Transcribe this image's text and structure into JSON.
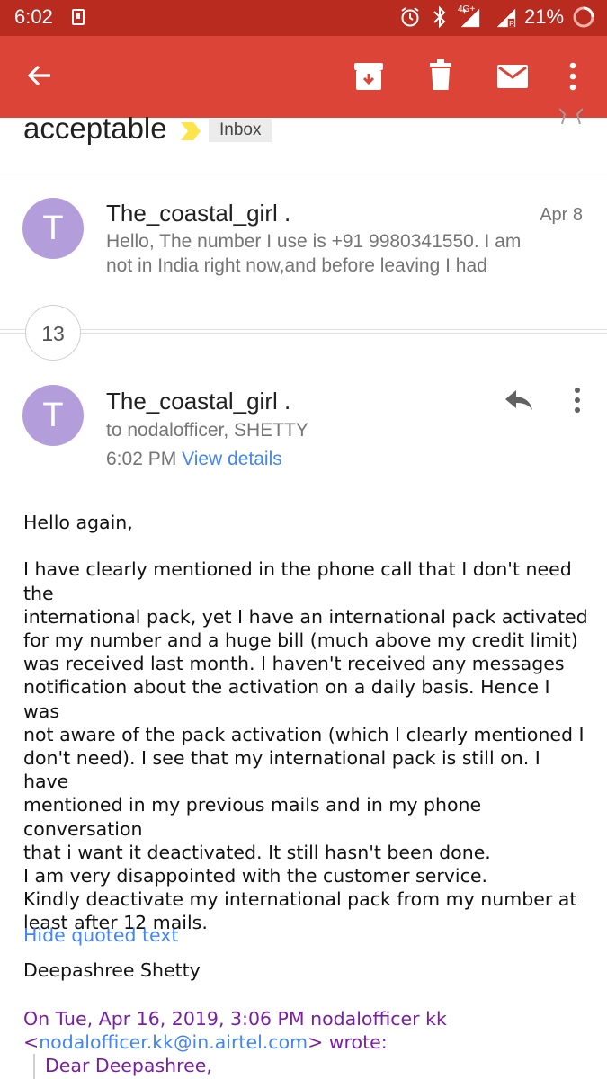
{
  "status_bar": {
    "time": "6:02",
    "battery": "21%",
    "network": "4G+"
  },
  "app_bar": {
    "icons": [
      "back-arrow-icon",
      "archive-icon",
      "delete-icon",
      "mail-icon",
      "more-vert-icon"
    ]
  },
  "thread": {
    "subject": "acceptable",
    "label": "Inbox",
    "collapsed_count": "13"
  },
  "messages": [
    {
      "avatar_letter": "T",
      "sender": "The_coastal_girl .",
      "date": "Apr 8",
      "snippet_line1": "Hello, The number I use is +91 9980341550. I am",
      "snippet_line2": "not in India right now,and before leaving I had"
    },
    {
      "avatar_letter": "T",
      "sender": "The_coastal_girl .",
      "recipients": "to nodalofficer, SHETTY",
      "time": "6:02 PM",
      "view_details": "View details",
      "body": {
        "greeting": "Hello again,",
        "paragraph": [
          "I have clearly mentioned in the phone call that I don't need the",
          "international pack, yet I have an international pack activated",
          "for my number and a huge bill (much above my credit limit)",
          "was received last month. I haven't received any messages",
          "notification about the activation on a daily basis. Hence I was",
          "not aware of the pack activation (which I clearly mentioned I",
          "don't need). I see that my international pack is still on. I have",
          "mentioned in my previous mails and in my phone conversation",
          "that i want it deactivated. It still hasn't been done.",
          "I am very disappointed with the customer service.",
          "Kindly deactivate my international pack from my number at",
          "least after 12 mails."
        ],
        "signature": "Deepashree Shetty",
        "hide_quoted": "Hide quoted text",
        "quote_header_line1": "On Tue, Apr 16, 2019, 3:06 PM nodalofficer kk",
        "quote_email": "nodalofficer.kk@in.airtel.com",
        "quote_open": "<",
        "quote_close": "> wrote:",
        "quote_greeting": "Dear Deepashree,"
      }
    }
  ],
  "colors": {
    "status_bar": "#b92a1f",
    "app_bar": "#db4437",
    "avatar": "#b39ddb",
    "link": "#4285f4",
    "quote_header": "#7b1fa2"
  }
}
